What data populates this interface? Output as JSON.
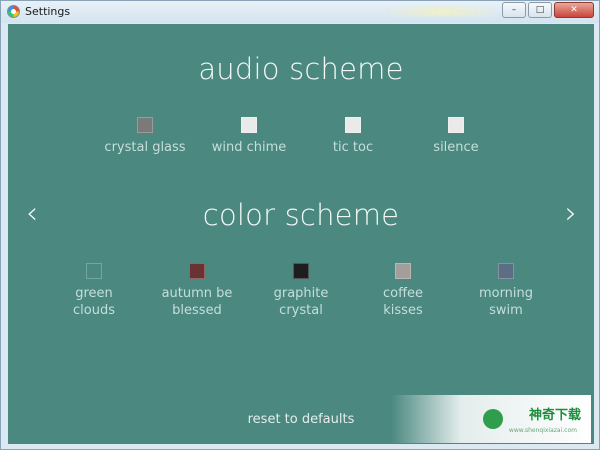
{
  "window": {
    "title": "Settings",
    "controls": {
      "minimize": "–",
      "maximize": "□",
      "close": "✕"
    }
  },
  "audio": {
    "title": "audio scheme",
    "options": [
      {
        "label": "crystal glass",
        "color": "#7a7a7a"
      },
      {
        "label": "wind chime",
        "color": "#eaeaea"
      },
      {
        "label": "tic toc",
        "color": "#eaeaea"
      },
      {
        "label": "silence",
        "color": "#eaeaea"
      }
    ]
  },
  "color": {
    "title": "color scheme",
    "options": [
      {
        "line1": "green",
        "line2": "clouds",
        "color": "#4a8880"
      },
      {
        "line1": "autumn be",
        "line2": "blessed",
        "color": "#6a3232"
      },
      {
        "line1": "graphite",
        "line2": "crystal",
        "color": "#1e1e1e"
      },
      {
        "line1": "coffee",
        "line2": "kisses",
        "color": "#a39e9a"
      },
      {
        "line1": "morning",
        "line2": "swim",
        "color": "#5b6e84"
      }
    ]
  },
  "nav": {
    "prev": "‹",
    "next": "›"
  },
  "reset_label": "reset to defaults",
  "watermark": {
    "text": "神奇下载",
    "sub": "www.shenqixiazai.com"
  },
  "colors": {
    "accent_bg": "#4a8880"
  }
}
